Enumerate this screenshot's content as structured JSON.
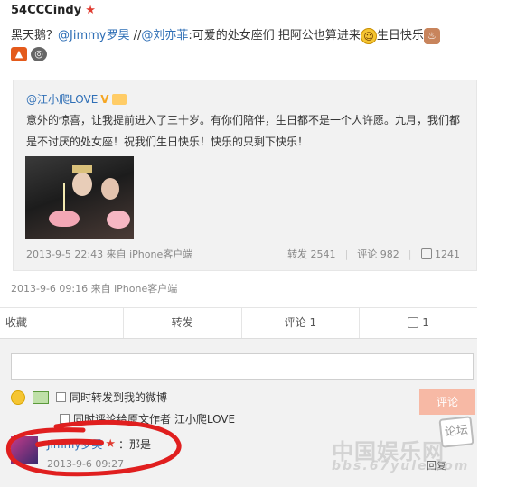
{
  "post": {
    "username": "54CCCindy",
    "text_prefix": "黑天鹅？",
    "mention_jimmy": "@Jimmy罗昊",
    "separator": " //",
    "mention_liuyifei": "@刘亦菲",
    "text_body": ":可爱的处女座们 把阿公也算进来",
    "text_suffix": "生日快乐",
    "meta": "2013-9-6 09:16 来自 iPhone客户端"
  },
  "repost": {
    "username": "@江小爬LOVE",
    "text": "意外的惊喜，让我提前进入了三十岁。有你们陪伴，生日都不是一个人许愿。九月，我们都是不讨厌的处女座！祝我们生日快乐！快乐的只剩下快乐！",
    "meta": "2013-9-5 22:43 来自 iPhone客户端",
    "repost_label": "转发 2541",
    "comment_label": "评论 982",
    "like_label": "1241"
  },
  "actions": {
    "favorite": "收藏",
    "repost": "转发",
    "comment": "评论 1",
    "like": "1"
  },
  "comment_box": {
    "repost_option": "同时转发到我的微博",
    "reply_option": "同时评论给原文作者 江小爬LOVE",
    "submit": "评论"
  },
  "comment": {
    "username": "Jimmy罗昊",
    "text": "：那是",
    "time": "2013-9-6 09:27",
    "reply": "回复"
  },
  "watermark": {
    "badge": "论坛",
    "site": "中国娱乐网",
    "domain": "bbs.67yule.com"
  },
  "colors": {
    "link": "#2f6fb6",
    "accent_red": "#e03c31",
    "submit_disabled": "#f7b9a5"
  }
}
